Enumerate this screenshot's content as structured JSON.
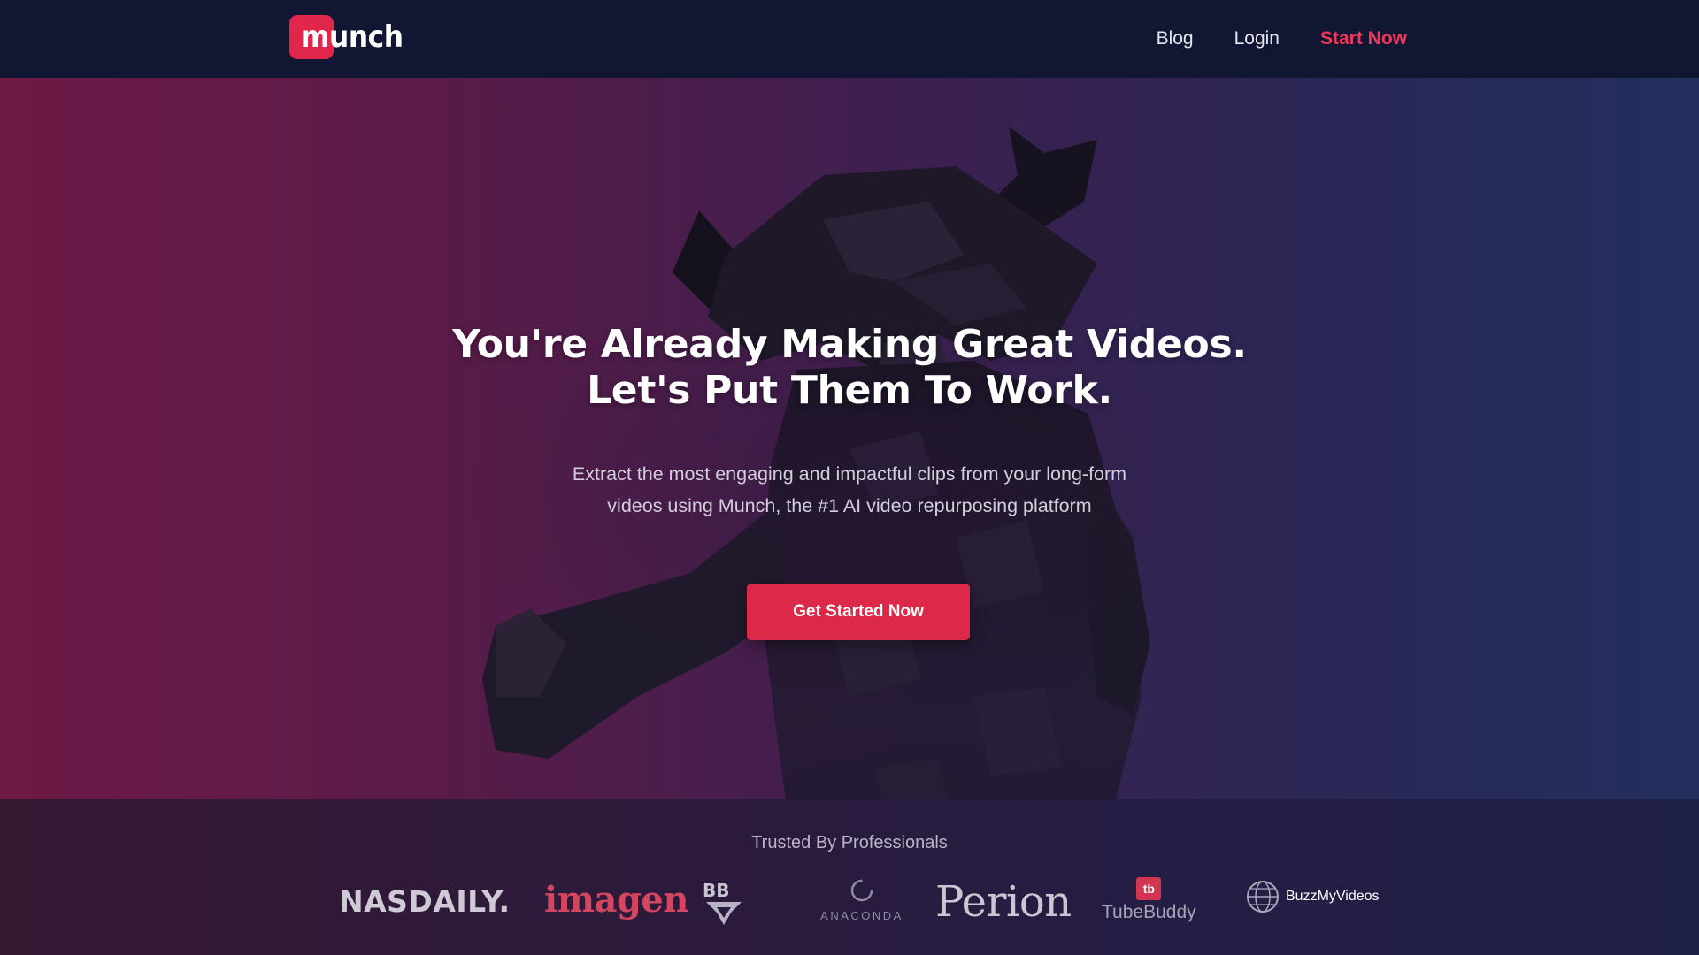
{
  "brand": {
    "name": "munch",
    "accent": "#dc2849"
  },
  "nav": {
    "links": [
      {
        "label": "Blog"
      },
      {
        "label": "Login"
      },
      {
        "label": "Start Now"
      }
    ]
  },
  "hero": {
    "headline_line1": "You're Already Making Great Videos.",
    "headline_line2": "Let's Put Them To Work.",
    "subtext_line1": "Extract the most engaging and impactful clips from your long-form",
    "subtext_line2": "videos using Munch, the #1 AI video repurposing platform",
    "cta_label": "Get Started Now",
    "background_image": "low-poly-bull-figure"
  },
  "trusted": {
    "label": "Trusted By Professionals",
    "logos": [
      {
        "name": "NASDAILY."
      },
      {
        "name": "imagen"
      },
      {
        "name": "BBTV"
      },
      {
        "name": "ANACONDA"
      },
      {
        "name": "Perion"
      },
      {
        "name": "TubeBuddy"
      },
      {
        "name": "BuzzMyVideos"
      }
    ]
  }
}
